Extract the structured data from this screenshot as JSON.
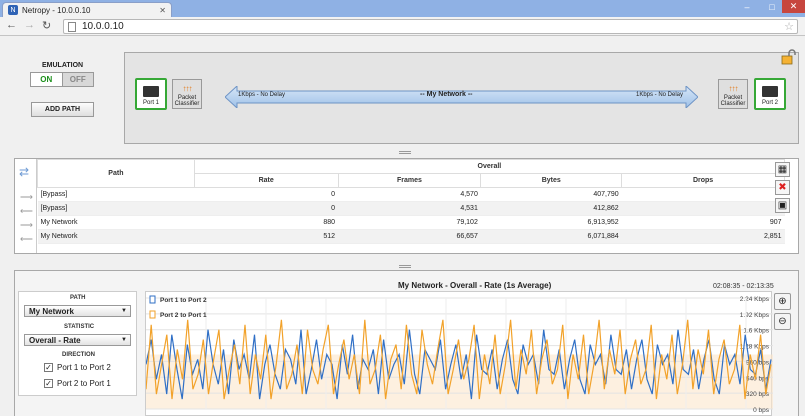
{
  "browser": {
    "tab_title": "Netropy - 10.0.0.10",
    "url": "10.0.0.10"
  },
  "emulation": {
    "label": "EMULATION",
    "on_label": "ON",
    "off_label": "OFF",
    "state": "ON",
    "add_path_label": "ADD PATH"
  },
  "topology": {
    "port1_label": "Port 1",
    "port2_label": "Port 2",
    "classifier_label_1": "Packet",
    "classifier_label_2": "Classifier",
    "link_name": "-- My Network --",
    "left_link_text": "1Kbps - No Delay",
    "right_link_text": "1Kbps - No Delay"
  },
  "table": {
    "path_header": "Path",
    "overall_header": "Overall",
    "columns": [
      "Rate",
      "Frames",
      "Bytes",
      "Drops"
    ],
    "rows": [
      {
        "direction": "right",
        "path": "[Bypass]",
        "rate": "0",
        "frames": "4,570",
        "bytes": "407,790",
        "drops": ""
      },
      {
        "direction": "left",
        "path": "[Bypass]",
        "rate": "0",
        "frames": "4,531",
        "bytes": "412,862",
        "drops": ""
      },
      {
        "direction": "right",
        "path": "My Network",
        "rate": "880",
        "frames": "79,102",
        "bytes": "6,913,952",
        "drops": "907"
      },
      {
        "direction": "left",
        "path": "My Network",
        "rate": "512",
        "frames": "66,657",
        "bytes": "6,071,884",
        "drops": "2,851"
      }
    ]
  },
  "chart_panel": {
    "title": "My Network - Overall - Rate (1s Average)",
    "time_range": "02:08:35 - 02:13:35",
    "path_label": "PATH",
    "path_value": "My Network",
    "statistic_label": "STATISTIC",
    "statistic_value": "Overall - Rate",
    "direction_label": "DIRECTION",
    "dir1_label": "Port 1 to Port 2",
    "dir2_label": "Port 2 to Port 1",
    "dir1_checked": true,
    "dir2_checked": true
  },
  "chart_data": {
    "type": "line",
    "title": "My Network - Overall - Rate (1s Average)",
    "y_ticks": [
      "2.24 Kbps",
      "1.92 Kbps",
      "1.6 Kbps",
      "1.28 Kbps",
      "960 bps",
      "640 bps",
      "320 bps",
      "0 bps"
    ],
    "ylim": [
      0,
      2240
    ],
    "colors": {
      "port1_to_port2": "#2f6fc6",
      "port2_to_port1": "#f2a22a"
    },
    "series": [
      {
        "name": "Port 1 to Port 2",
        "values": [
          900,
          1400,
          600,
          1100,
          300,
          1500,
          800,
          200,
          1300,
          700,
          1000,
          400,
          1600,
          900,
          500,
          1200,
          300,
          1400,
          800,
          1100,
          600,
          1500,
          200,
          900,
          1300,
          700,
          400,
          1200,
          1000,
          500,
          1600,
          300,
          800,
          1400,
          600,
          1100,
          900,
          200,
          1300,
          700,
          1500,
          400,
          1000,
          800,
          1200,
          300,
          1400,
          600,
          900,
          1100,
          500,
          1600,
          700,
          300,
          1200,
          1000,
          800,
          1400,
          400,
          900,
          1300,
          600,
          1100,
          200,
          1500,
          800,
          700,
          1200,
          400,
          1000,
          1400,
          600,
          300,
          1300,
          900,
          1100,
          500,
          1600,
          800,
          700,
          1200,
          400,
          1000,
          1400,
          600,
          300,
          1300,
          900,
          1100,
          500,
          1500,
          800,
          700,
          1200,
          400,
          1000,
          1400,
          600,
          300,
          1300,
          900,
          1100,
          500,
          1600,
          800,
          700,
          1200,
          400,
          1000,
          1400,
          600,
          300,
          1300,
          900,
          1100,
          500,
          1500,
          800,
          700,
          1200,
          400,
          1000
        ]
      },
      {
        "name": "Port 2 to Port 1",
        "values": [
          400,
          1700,
          300,
          900,
          1500,
          200,
          1200,
          600,
          1800,
          400,
          700,
          1400,
          300,
          1000,
          1600,
          200,
          800,
          1300,
          500,
          1700,
          300,
          1100,
          600,
          1500,
          200,
          900,
          1800,
          400,
          700,
          1300,
          300,
          1600,
          800,
          500,
          1200,
          1700,
          300,
          900,
          1400,
          600,
          1100,
          300,
          1800,
          500,
          800,
          1500,
          200,
          1000,
          1300,
          400,
          1700,
          700,
          300,
          1600,
          900,
          500,
          1200,
          1800,
          300,
          800,
          1400,
          600,
          1000,
          1700,
          200,
          1100,
          500,
          1500,
          300,
          900,
          1800,
          400,
          1200,
          700,
          1600,
          300,
          1000,
          1400,
          500,
          800,
          1700,
          200,
          1100,
          600,
          1500,
          300,
          900,
          1800,
          400,
          1200,
          700,
          1600,
          300,
          1000,
          1400,
          500,
          800,
          1700,
          200,
          1100,
          600,
          1500,
          300,
          900,
          1800,
          400,
          1200,
          700,
          1600,
          300,
          1000,
          1400,
          500,
          800,
          1700,
          200,
          1100,
          600,
          1500,
          300,
          900
        ]
      }
    ]
  }
}
